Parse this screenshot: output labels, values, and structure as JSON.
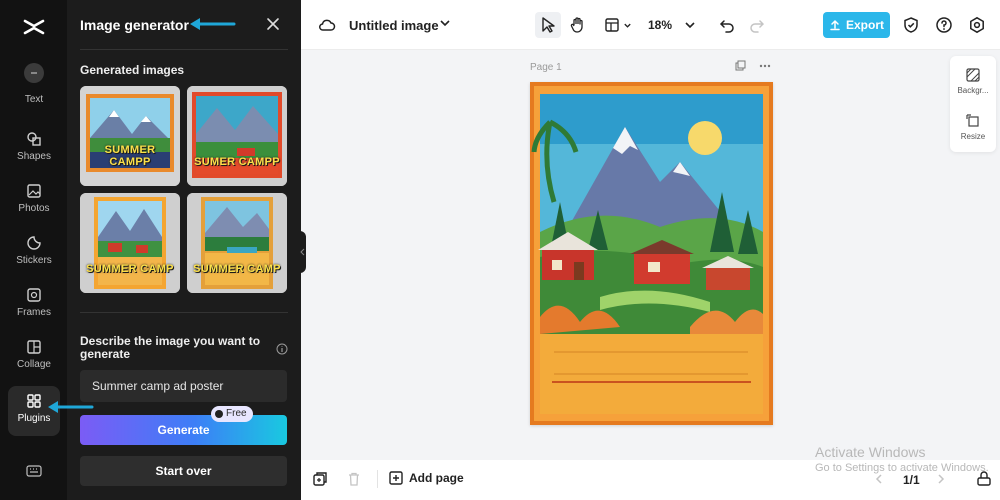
{
  "rail": {
    "items": [
      {
        "label": "Text"
      },
      {
        "label": "Shapes"
      },
      {
        "label": "Photos"
      },
      {
        "label": "Stickers"
      },
      {
        "label": "Frames"
      },
      {
        "label": "Collage"
      },
      {
        "label": "Plugins"
      }
    ]
  },
  "panel": {
    "title": "Image generator",
    "generated_label": "Generated images",
    "thumbnails": [
      {
        "text": "SUMMER CAMPP"
      },
      {
        "text": "SUMER CAMPP"
      },
      {
        "text": "SUMMER CAMP"
      },
      {
        "text": "SUMMER CAMP"
      }
    ],
    "describe_label": "Describe the image you want to generate",
    "prompt_value": "Summer camp ad poster",
    "generate_label": "Generate",
    "free_badge": "Free",
    "start_over_label": "Start over"
  },
  "topbar": {
    "doc_title": "Untitled image",
    "zoom": "18%",
    "export_label": "Export"
  },
  "canvas": {
    "page_label": "Page 1"
  },
  "side_tools": {
    "items": [
      {
        "label": "Backgr..."
      },
      {
        "label": "Resize"
      }
    ]
  },
  "bottombar": {
    "add_page_label": "Add page",
    "page_count": "1/1"
  },
  "watermark": {
    "line1": "Activate Windows",
    "line2": "Go to Settings to activate Windows."
  },
  "colors": {
    "accent": "#2bb7ea",
    "rail_bg": "#121212",
    "panel_bg": "#1c1c1c",
    "arrow": "#1fa7d8"
  }
}
